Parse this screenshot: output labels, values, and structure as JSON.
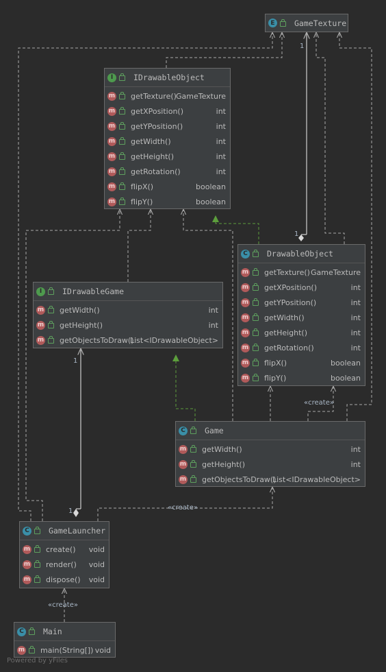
{
  "colors": {
    "background": "#2b2b2b",
    "node": "#3c3f41",
    "edge": "#a9a9a9",
    "implements": "#5c9e3c"
  },
  "nodes": {
    "game_texture": {
      "badge": "E",
      "name": "GameTexture",
      "members": []
    },
    "idrawable_object": {
      "badge": "I",
      "name": "IDrawableObject",
      "members": [
        {
          "name": "getTexture()",
          "type": "GameTexture"
        },
        {
          "name": "getXPosition()",
          "type": "int"
        },
        {
          "name": "getYPosition()",
          "type": "int"
        },
        {
          "name": "getWidth()",
          "type": "int"
        },
        {
          "name": "getHeight()",
          "type": "int"
        },
        {
          "name": "getRotation()",
          "type": "int"
        },
        {
          "name": "flipX()",
          "type": "boolean"
        },
        {
          "name": "flipY()",
          "type": "boolean"
        }
      ]
    },
    "drawable_object": {
      "badge": "C",
      "name": "DrawableObject",
      "members": [
        {
          "name": "getTexture()",
          "type": "GameTexture"
        },
        {
          "name": "getXPosition()",
          "type": "int"
        },
        {
          "name": "getYPosition()",
          "type": "int"
        },
        {
          "name": "getWidth()",
          "type": "int"
        },
        {
          "name": "getHeight()",
          "type": "int"
        },
        {
          "name": "getRotation()",
          "type": "int"
        },
        {
          "name": "flipX()",
          "type": "boolean"
        },
        {
          "name": "flipY()",
          "type": "boolean"
        }
      ]
    },
    "idrawable_game": {
      "badge": "I",
      "name": "IDrawableGame",
      "members": [
        {
          "name": "getWidth()",
          "type": "int"
        },
        {
          "name": "getHeight()",
          "type": "int"
        },
        {
          "name": "getObjectsToDraw()",
          "type": "List<IDrawableObject>"
        }
      ]
    },
    "game": {
      "badge": "C",
      "name": "Game",
      "members": [
        {
          "name": "getWidth()",
          "type": "int"
        },
        {
          "name": "getHeight()",
          "type": "int"
        },
        {
          "name": "getObjectsToDraw()",
          "type": "List<IDrawableObject>"
        }
      ]
    },
    "game_launcher": {
      "badge": "C",
      "name": "GameLauncher",
      "members": [
        {
          "name": "create()",
          "type": "void"
        },
        {
          "name": "render()",
          "type": "void"
        },
        {
          "name": "dispose()",
          "type": "void"
        }
      ]
    },
    "main": {
      "badge": "C",
      "name": "Main",
      "members": [
        {
          "name": "main(String[])",
          "type": "void"
        }
      ]
    }
  },
  "member_badge": "m",
  "edge_labels": {
    "create_game_drawable": "«create»",
    "create_launcher_game": "«create»",
    "create_main_launcher": "«create»",
    "mult_texture_drawable": "1",
    "mult_texture_at_drawable": "1",
    "mult_launcher_game": "1",
    "mult_launcher_at": "1"
  },
  "watermark": "Powered by yFiles"
}
